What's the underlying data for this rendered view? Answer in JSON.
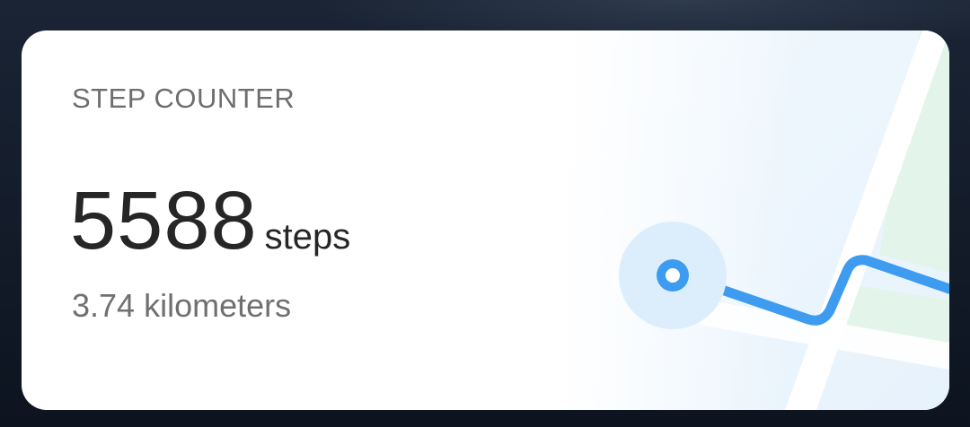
{
  "widget": {
    "title": "STEP COUNTER",
    "steps_value": "5588",
    "steps_unit": "steps",
    "distance": "3.74 kilometers"
  },
  "colors": {
    "route": "#3d9bf0",
    "location_halo": "#dceefc",
    "map_park": "#e3f5ea",
    "card_background": "#ffffff"
  },
  "icons": {
    "location": "location-pin-icon"
  }
}
